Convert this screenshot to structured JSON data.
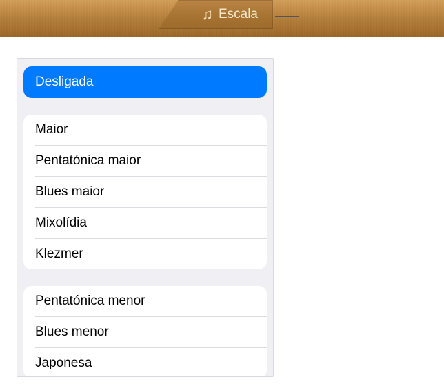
{
  "header": {
    "tab_label": "Escala"
  },
  "scale_menu": {
    "selected": "Desligada",
    "groups": [
      {
        "items": [
          "Maior",
          "Pentatónica maior",
          "Blues maior",
          "Mixolídia",
          "Klezmer"
        ]
      },
      {
        "items": [
          "Pentatónica menor",
          "Blues menor",
          "Japonesa"
        ]
      }
    ]
  }
}
